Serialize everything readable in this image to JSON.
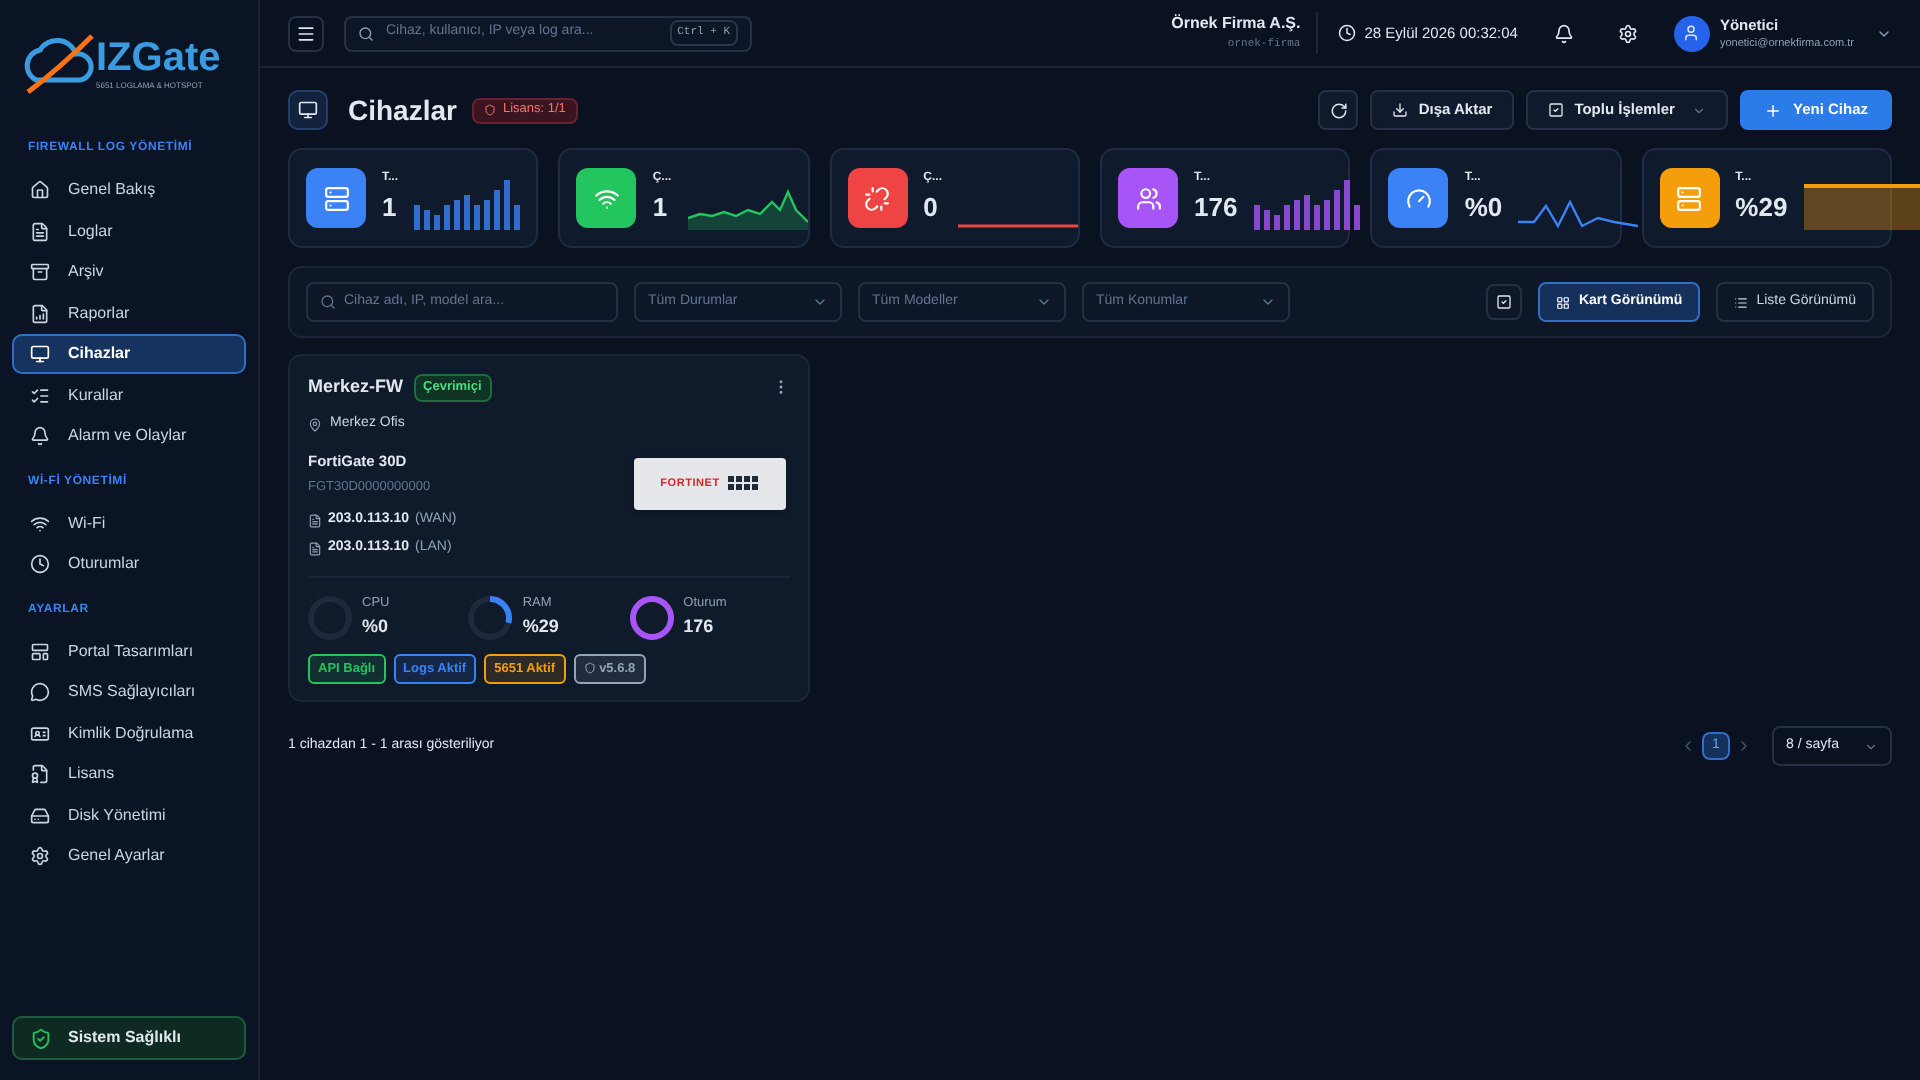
{
  "brand": {
    "name": "IZGate",
    "tagline": "5651 LOGLAMA & HOTSPOT"
  },
  "sidebar": {
    "sections": [
      {
        "title": "FIREWALL LOG YÖNETİMİ",
        "items": [
          {
            "label": "Genel Bakış",
            "selected": false
          },
          {
            "label": "Loglar",
            "selected": false
          },
          {
            "label": "Arşiv",
            "selected": false
          },
          {
            "label": "Raporlar",
            "selected": false
          },
          {
            "label": "Cihazlar",
            "selected": true
          },
          {
            "label": "Kurallar",
            "selected": false
          },
          {
            "label": "Alarm ve Olaylar",
            "selected": false
          }
        ]
      },
      {
        "title": "Wİ-Fİ YÖNETİMİ",
        "items": [
          {
            "label": "Wi-Fi",
            "selected": false
          },
          {
            "label": "Oturumlar",
            "selected": false
          }
        ]
      },
      {
        "title": "AYARLAR",
        "items": [
          {
            "label": "Portal Tasarımları",
            "selected": false
          },
          {
            "label": "SMS Sağlayıcıları",
            "selected": false
          },
          {
            "label": "Kimlik Doğrulama",
            "selected": false
          },
          {
            "label": "Lisans",
            "selected": false
          },
          {
            "label": "Disk Yönetimi",
            "selected": false
          },
          {
            "label": "Genel Ayarlar",
            "selected": false
          }
        ]
      }
    ],
    "health": "Sistem Sağlıklı"
  },
  "topbar": {
    "search_placeholder": "Cihaz, kullanıcı, IP veya log ara...",
    "shortcut": "Ctrl + K",
    "company": "Örnek Firma A.Ş.",
    "company_slug": "ornek-firma",
    "datetime": "28 Eylül 2026 00:32:04",
    "user": {
      "name": "Yönetici",
      "email": "yonetici@ornekfirma.com.tr"
    }
  },
  "page": {
    "title": "Cihazlar",
    "license": "Lisans: 1/1",
    "actions": {
      "export": "Dışa Aktar",
      "bulk": "Toplu İşlemler",
      "new": "Yeni Cihaz"
    }
  },
  "stats": [
    {
      "label": "T...",
      "value": "1",
      "color": "#3b82f6",
      "kind": "bars"
    },
    {
      "label": "Ç...",
      "value": "1",
      "color": "#22c55e",
      "kind": "area"
    },
    {
      "label": "Ç...",
      "value": "0",
      "color": "#ef4444",
      "kind": "flat"
    },
    {
      "label": "T...",
      "value": "176",
      "color": "#a855f7",
      "kind": "bars"
    },
    {
      "label": "T...",
      "value": "%0",
      "color": "#3b82f6",
      "kind": "line"
    },
    {
      "label": "T...",
      "value": "%29",
      "color": "#f59e0b",
      "kind": "fill"
    }
  ],
  "filters": {
    "search_placeholder": "Cihaz adı, IP, model ara...",
    "dropdowns": [
      "Tüm Durumlar",
      "Tüm Modeller",
      "Tüm Konumlar"
    ],
    "views": [
      {
        "label": "Kart Görünümü",
        "selected": true
      },
      {
        "label": "Liste Görünümü",
        "selected": false
      }
    ]
  },
  "devices": [
    {
      "name": "Merkez-FW",
      "status": "Çevrimiçi",
      "location": "Merkez Ofis",
      "model": "FortiGate 30D",
      "serial": "FGT30D0000000000",
      "brand": "FORTINET",
      "interfaces": [
        {
          "ip": "203.0.113.10",
          "type": "(WAN)"
        },
        {
          "ip": "203.0.113.10",
          "type": "(LAN)"
        }
      ],
      "meters": [
        {
          "label": "CPU",
          "value": "%0",
          "level": 0
        },
        {
          "label": "RAM",
          "value": "%29",
          "level": 0.29,
          "color": "#3b82f6"
        },
        {
          "label": "Oturum",
          "value": "176",
          "level": 1,
          "color": "#a855f7"
        }
      ],
      "tags": [
        {
          "label": "API Bağlı",
          "color": "#22c55e",
          "kind": "text"
        },
        {
          "label": "Logs Aktif",
          "color": "#3b82f6",
          "kind": "text"
        },
        {
          "label": "5651 Aktif",
          "color": "#f59e0b",
          "kind": "text"
        },
        {
          "label": "v5.6.8",
          "color": "#94a3b8",
          "kind": "version"
        }
      ]
    }
  ],
  "footer": {
    "summary": "1 cihazdan 1 - 1 arası gösteriliyor",
    "pages": [
      {
        "label": "1",
        "selected": true
      }
    ],
    "page_size": "8 / sayfa"
  }
}
